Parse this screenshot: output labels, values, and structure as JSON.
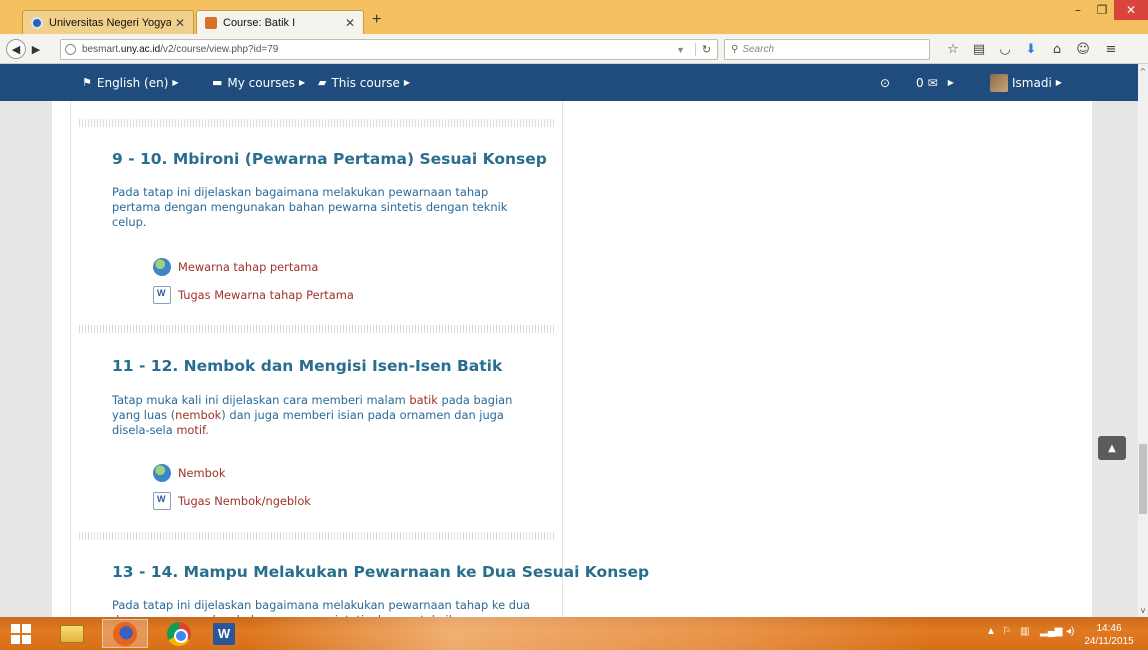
{
  "browser": {
    "tabs": [
      {
        "label": "Universitas Negeri Yogyak..."
      },
      {
        "label": "Course: Batik I"
      }
    ],
    "url": {
      "prefix": "besmart.",
      "host": "uny.ac.id",
      "path": "/v2/course/view.php?id=79"
    },
    "search_placeholder": "Search"
  },
  "moodle_nav": {
    "language": "English (en)",
    "my_courses": "My courses",
    "this_course": "This course",
    "messages_count": "0",
    "user_name": "Ismadi"
  },
  "sections": [
    {
      "title": "9 - 10. Mbironi (Pewarna Pertama) Sesuai Konsep",
      "summary": "Pada tatap ini dijelaskan bagaimana melakukan pewarnaan tahap pertama dengan mengunakan bahan pewarna sintetis dengan teknik celup.",
      "activities": [
        {
          "label": "Mewarna tahap pertama",
          "icon": "url-icon"
        },
        {
          "label": "Tugas Mewarna tahap Pertama",
          "icon": "assignment-icon"
        }
      ]
    },
    {
      "title": "11 - 12. Nembok dan Mengisi Isen-Isen Batik",
      "summary_parts": {
        "a": "Tatap muka kali ini dijelaskan cara memberi malam ",
        "b": "batik",
        "c": " pada bagian yang luas (",
        "d": "nembok",
        "e": ") dan juga memberi isian pada ornamen dan juga disela-sela ",
        "f": "motif",
        "g": "."
      },
      "activities": [
        {
          "label": "Nembok",
          "icon": "url-icon"
        },
        {
          "label": "Tugas Nembok/ngeblok",
          "icon": "assignment-icon"
        }
      ]
    },
    {
      "title": "13 - 14. Mampu Melakukan Pewarnaan ke Dua Sesuai Konsep",
      "summary": "Pada tatap ini dijelaskan bagaimana melakukan pewarnaan tahap ke dua dengan mengunakan bahan pewarna sintetis dengan teknik"
    }
  ],
  "taskbar": {
    "time": "14:46",
    "date": "24/11/2015"
  }
}
